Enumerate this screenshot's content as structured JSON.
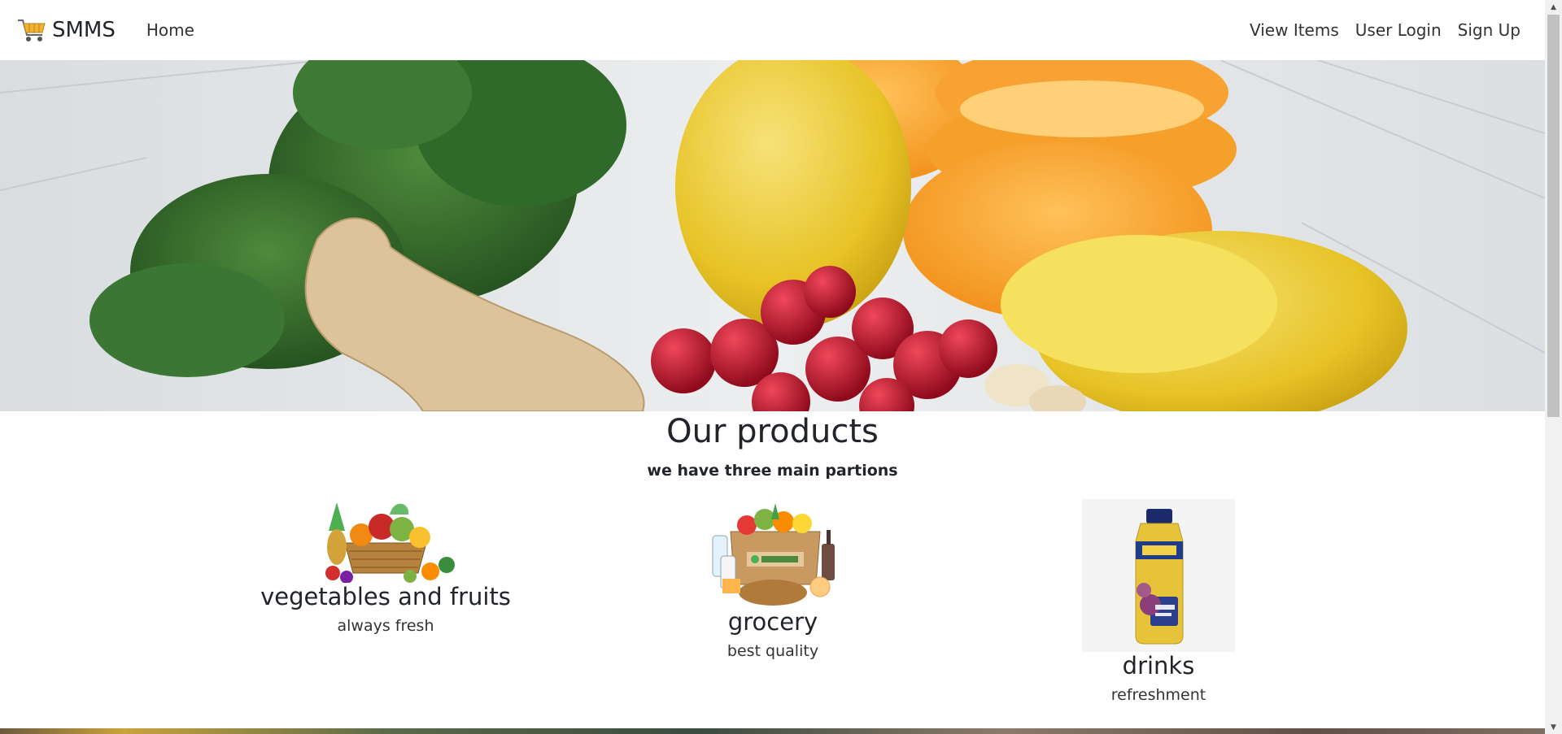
{
  "navbar": {
    "brand": "SMMS",
    "home": "Home",
    "links": [
      "View Items",
      "User Login",
      "Sign Up"
    ]
  },
  "products": {
    "title": "Our products",
    "subtitle": "we have three main partions",
    "cards": [
      {
        "title": "vegetables and fruits",
        "text": "always fresh"
      },
      {
        "title": "grocery",
        "text": "best quality"
      },
      {
        "title": "drinks",
        "text": "refreshment"
      }
    ]
  },
  "icons": {
    "brand": "shopping-cart-icon"
  },
  "colors": {
    "text": "#212529",
    "background": "#ffffff"
  }
}
